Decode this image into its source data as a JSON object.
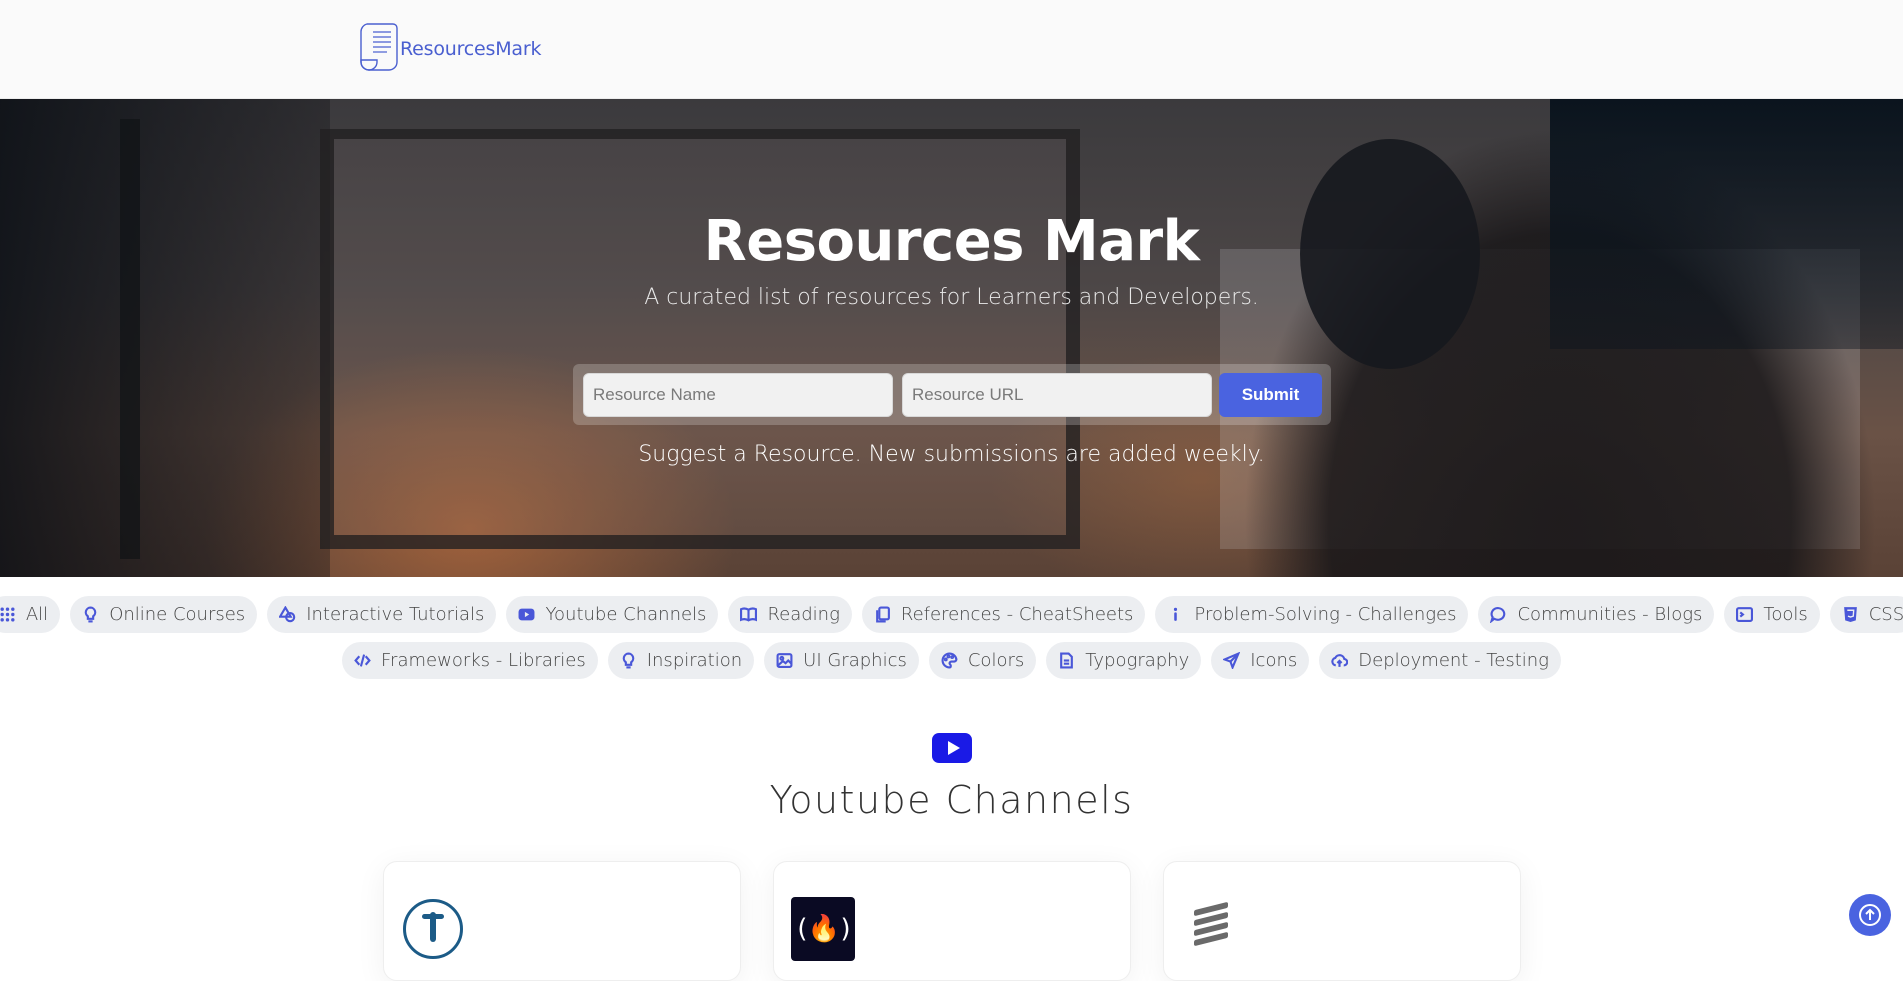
{
  "header": {
    "logo_text": "ResourcesMark"
  },
  "hero": {
    "title": "Resources Mark",
    "subtitle": "A curated list of resources for Learners and Developers.",
    "form": {
      "name_placeholder": "Resource Name",
      "url_placeholder": "Resource URL",
      "submit_label": "Submit"
    },
    "note": "Suggest a Resource. New submissions are added weekly."
  },
  "categories": {
    "row1": [
      {
        "label": "All",
        "icon": "grid-icon"
      },
      {
        "label": "Online Courses",
        "icon": "lightbulb-icon"
      },
      {
        "label": "Interactive Tutorials",
        "icon": "shapes-icon"
      },
      {
        "label": "Youtube Channels",
        "icon": "youtube-icon"
      },
      {
        "label": "Reading",
        "icon": "book-open-icon"
      },
      {
        "label": "References - CheatSheets",
        "icon": "files-icon"
      },
      {
        "label": "Problem-Solving - Challenges",
        "icon": "info-icon"
      },
      {
        "label": "Communities - Blogs",
        "icon": "chat-icon"
      },
      {
        "label": "Tools",
        "icon": "terminal-icon"
      },
      {
        "label": "CSS",
        "icon": "css3-icon"
      }
    ],
    "row2": [
      {
        "label": "Frameworks - Libraries",
        "icon": "code-icon"
      },
      {
        "label": "Inspiration",
        "icon": "lightbulb-icon"
      },
      {
        "label": "UI Graphics",
        "icon": "images-icon"
      },
      {
        "label": "Colors",
        "icon": "palette-icon"
      },
      {
        "label": "Typography",
        "icon": "file-text-icon"
      },
      {
        "label": "Icons",
        "icon": "send-icon"
      },
      {
        "label": "Deployment - Testing",
        "icon": "cloud-upload-icon"
      }
    ]
  },
  "section": {
    "title": "Youtube Channels",
    "icon": "youtube-icon"
  },
  "cards": [
    {
      "avatar_icon": "traversy-logo-icon"
    },
    {
      "avatar_icon": "freecodecamp-logo-icon",
      "avatar_text": "(🔥)"
    },
    {
      "avatar_icon": "stripes-logo-icon"
    }
  ],
  "colors": {
    "accent": "#4a63e0",
    "youtube": "#1a1ae6"
  }
}
